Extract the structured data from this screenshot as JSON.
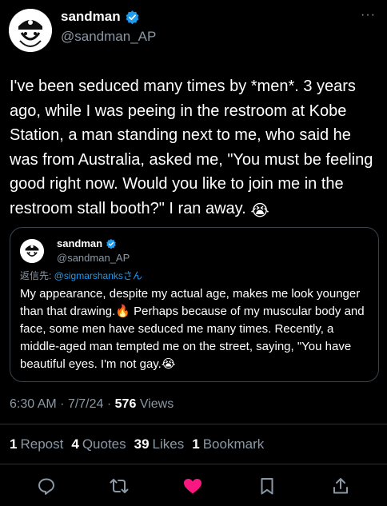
{
  "author": {
    "name": "sandman",
    "handle": "@sandman_AP"
  },
  "more_label": "···",
  "tweet": {
    "text": "I've been seduced many times by *men*. 3 years ago, while I was peeing in the restroom at Kobe Station, a man standing next to me, who said he was from Australia, asked me, \"You must be feeling good right now. Would you like to join me in the restroom stall booth?\" I ran away.",
    "emoji": "😭"
  },
  "quote": {
    "name": "sandman",
    "handle": "@sandman_AP",
    "reply_prefix": "返信先: ",
    "reply_mention": "@sigmarshanksさん",
    "text_part1": "My appearance, despite my actual age, makes me look younger than that drawing.",
    "emoji1": "🔥",
    "text_part2": " Perhaps because of my muscular body and face, some men have seduced me many times. Recently, a middle-aged man tempted me on the street, saying, \"You have beautiful eyes. I'm not gay.",
    "emoji2": "😭"
  },
  "meta": {
    "time": "6:30 AM",
    "date": "7/7/24",
    "views_count": "576",
    "views_label": "Views"
  },
  "stats": [
    {
      "count": "1",
      "label": "Repost"
    },
    {
      "count": "4",
      "label": "Quotes"
    },
    {
      "count": "39",
      "label": "Likes"
    },
    {
      "count": "1",
      "label": "Bookmark"
    }
  ],
  "colors": {
    "background": "#000000",
    "text": "#ffffff",
    "secondary": "#8b98a5",
    "accent": "#1d9bf0",
    "like": "#f91880"
  },
  "icons": [
    "reply-icon",
    "repost-icon",
    "like-icon-filled",
    "bookmark-icon",
    "share-icon"
  ]
}
